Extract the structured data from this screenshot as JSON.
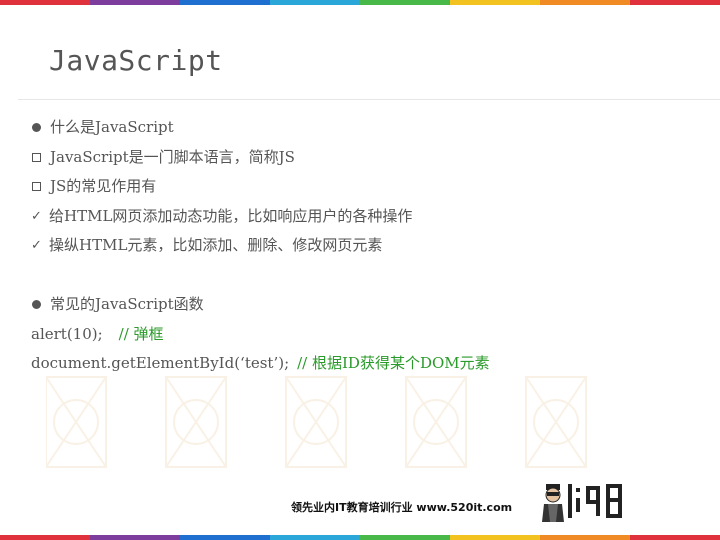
{
  "stripe_colors": [
    "#e0323c",
    "#7c3d9c",
    "#1f6fd0",
    "#2aa6d8",
    "#48b848",
    "#f2c320",
    "#f08a24",
    "#e0323c"
  ],
  "slide": {
    "title": "JavaScript",
    "lines": [
      {
        "marker": "dot",
        "text": "什么是JavaScript"
      },
      {
        "marker": "square",
        "text": "JavaScript是一门脚本语言，简称JS"
      },
      {
        "marker": "square",
        "text": "JS的常见作用有"
      },
      {
        "marker": "check",
        "text": "给HTML网页添加动态功能，比如响应用户的各种操作"
      },
      {
        "marker": "check",
        "text": "操纵HTML元素，比如添加、删除、修改网页元素"
      },
      {
        "marker": "none",
        "text": ""
      },
      {
        "marker": "dot",
        "text": "常见的JavaScript函数"
      }
    ],
    "code1": {
      "code": "alert(10);",
      "comment": "// 弹框"
    },
    "code2": {
      "code": "document.getElementById(‘test’);",
      "comment": "// 根据ID获得某个DOM元素"
    }
  },
  "footer": {
    "tagline": "领先业内IT教育培训行业 www.520it.com",
    "logo_icon": "520it-logo-icon"
  }
}
